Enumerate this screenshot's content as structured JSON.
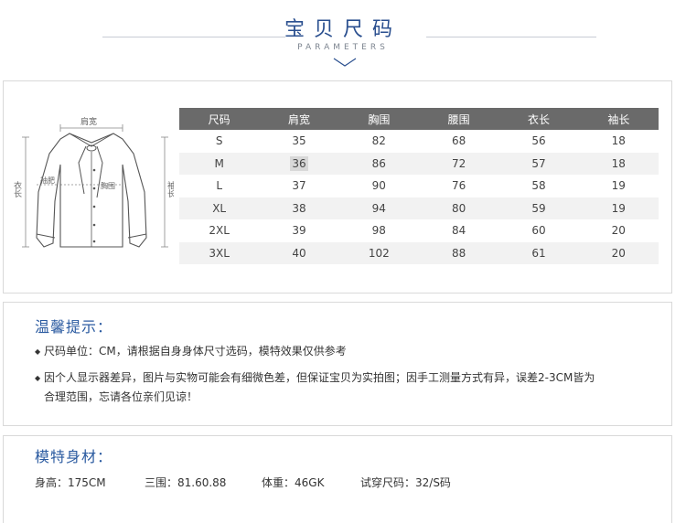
{
  "header": {
    "title": "宝贝尺码",
    "subtitle": "PARAMETERS"
  },
  "sketch": {
    "labels": {
      "shoulder": "肩宽",
      "length": "衣长",
      "sleeve": "袖长",
      "chest": "胸围",
      "sleeve_width": "袖肥"
    }
  },
  "size_table": {
    "headers": [
      "尺码",
      "肩宽",
      "胸围",
      "腰围",
      "衣长",
      "袖长"
    ],
    "rows": [
      [
        "S",
        "35",
        "82",
        "68",
        "56",
        "18"
      ],
      [
        "M",
        "36",
        "86",
        "72",
        "57",
        "18"
      ],
      [
        "L",
        "37",
        "90",
        "76",
        "58",
        "19"
      ],
      [
        "XL",
        "38",
        "94",
        "80",
        "59",
        "19"
      ],
      [
        "2XL",
        "39",
        "98",
        "84",
        "60",
        "20"
      ],
      [
        "3XL",
        "40",
        "102",
        "88",
        "61",
        "20"
      ]
    ]
  },
  "tips": {
    "title": "温馨提示：",
    "items": [
      "尺码单位：CM，请根据自身身体尺寸选码，模特效果仅供参考",
      "因个人显示器差异，图片与实物可能会有细微色差，但保证宝贝为实拍图；因手工测量方式有异，误差2-3CM皆为",
      "合理范围，忘请各位亲们见谅！"
    ]
  },
  "model": {
    "title": "模特身材：",
    "height": "身高：175CM",
    "measurements": "三围：81.60.88",
    "weight": "体重：46GK",
    "size": "试穿尺码：32/S码"
  },
  "colors": {
    "accent": "#2a5aa0",
    "table_header": "#6a6a6a"
  }
}
